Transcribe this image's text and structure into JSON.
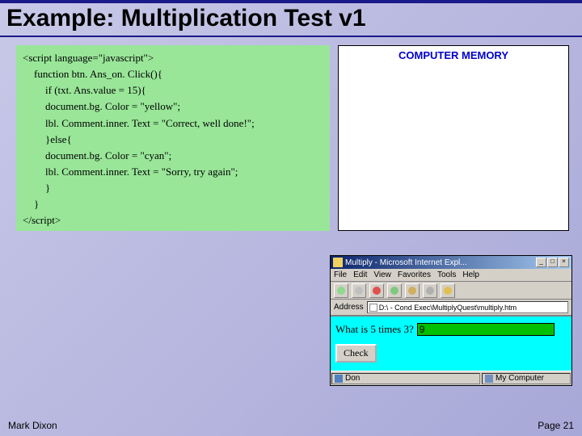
{
  "slide": {
    "title": "Example: Multiplication Test v1",
    "author": "Mark Dixon",
    "page_label": "Page 21"
  },
  "code": {
    "l1": "<script language=\"javascript\">",
    "l2": "function btn. Ans_on. Click(){",
    "l3": "if (txt. Ans.value = 15){",
    "l4": "document.bg. Color = \"yellow\";",
    "l5": "lbl. Comment.inner. Text = \"Correct, well done!\";",
    "l6": "}else{",
    "l7": "document.bg. Color = \"cyan\";",
    "l8": "lbl. Comment.inner. Text = \"Sorry, try again\";",
    "l9": "}",
    "l10": "}",
    "l11": "</script>"
  },
  "memory": {
    "title": "COMPUTER MEMORY"
  },
  "browser": {
    "window_title": "Multiply - Microsoft Internet Expl...",
    "menu": {
      "file": "File",
      "edit": "Edit",
      "view": "View",
      "favorites": "Favorites",
      "tools": "Tools",
      "help": "Help"
    },
    "address_label": "Address",
    "address_value": "D:\\ - Cond Exec\\MultiplyQuest\\multiply.htm",
    "question": "What is 5 times 3?",
    "answer_value": "9",
    "check_label": "Check",
    "status_left": "Don",
    "status_right": "My Computer",
    "btn_min": "_",
    "btn_max": "□",
    "btn_close": "×"
  }
}
